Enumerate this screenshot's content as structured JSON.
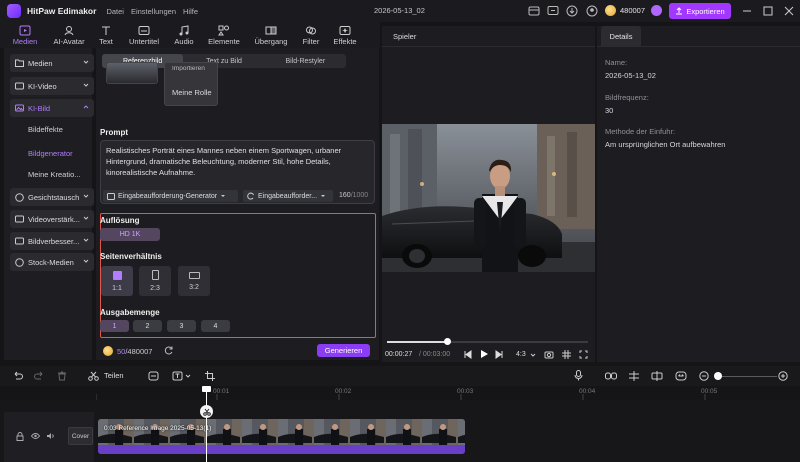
{
  "app": {
    "name": "HitPaw Edimakor",
    "menu": [
      "Datei",
      "Einstellungen",
      "Hilfe"
    ],
    "project_name": "2026-05-13_02",
    "credits": "480007",
    "export_label": "Exportieren"
  },
  "toolbar": [
    {
      "label": "Medien",
      "icon": "media-icon"
    },
    {
      "label": "AI-Avatar",
      "icon": "avatar-icon"
    },
    {
      "label": "Text",
      "icon": "text-icon"
    },
    {
      "label": "Untertitel",
      "icon": "subtitle-icon"
    },
    {
      "label": "Audio",
      "icon": "audio-icon"
    },
    {
      "label": "Elemente",
      "icon": "elements-icon"
    },
    {
      "label": "Übergang",
      "icon": "transition-icon"
    },
    {
      "label": "Filter",
      "icon": "filter-icon"
    },
    {
      "label": "Effekte",
      "icon": "effects-icon"
    }
  ],
  "sidebar": {
    "items": [
      {
        "label": "Medien"
      },
      {
        "label": "KI-Video"
      },
      {
        "label": "KI-Bild"
      },
      {
        "label": "Gesichtstausch"
      },
      {
        "label": "Videoverstärk..."
      },
      {
        "label": "Bildverbesser..."
      },
      {
        "label": "Stock-Medien"
      }
    ],
    "sub_items": [
      {
        "label": "Bildeffekte"
      },
      {
        "label": "Bildgenerator"
      },
      {
        "label": "Meine Kreatio..."
      }
    ]
  },
  "generator": {
    "tabs": [
      "Referenzbild",
      "Text zu Bild",
      "Bild-Restyler"
    ],
    "import_label": "Importieren",
    "role_label": "Meine Rolle",
    "prompt_title": "Prompt",
    "prompt_text": "Realistisches Porträt eines Mannes neben einem Sportwagen, urbaner Hintergrund, dramatische Beleuchtung, moderner Stil, hohe Details, kinorealistische Aufnahme.",
    "prompt_generator": "Eingabeaufforderung-Generator",
    "prompt_template": "Eingabeaufforder...",
    "char_count": "160",
    "char_max": "/1000",
    "resolution_title": "Auflösung",
    "resolution_value": "HD 1K",
    "ratio_title": "Seitenverhältnis",
    "ratios": [
      "1:1",
      "2:3",
      "3:2"
    ],
    "amount_title": "Ausgabemenge",
    "amounts": [
      "1",
      "2",
      "3",
      "4"
    ],
    "cost_used": "50",
    "cost_total": "/480007",
    "generate_label": "Generieren"
  },
  "player": {
    "title": "Spieler",
    "time_current": "00:00:27",
    "time_total": "/ 00:03:00",
    "aspect": "4:3",
    "progress": 0.3
  },
  "details": {
    "tab": "Details",
    "name_label": "Name:",
    "name_value": "2026-05-13_02",
    "fps_label": "Bildfrequenz:",
    "fps_value": "30",
    "insert_label": "Methode der Einfuhr:",
    "insert_value": "Am ursprünglichen Ort aufbewahren"
  },
  "timeline": {
    "split_label": "Teilen",
    "ruler": [
      "00:01",
      "00:02",
      "00:03",
      "00:04",
      "00:05"
    ],
    "cover_label": "Cover",
    "clip_label": "0:03 Reference Image 2025-05-13(1)"
  },
  "colors": {
    "accent": "#a238ff",
    "highlight_border": "#e2574c",
    "panel": "#1d1d21",
    "background": "#151518"
  }
}
